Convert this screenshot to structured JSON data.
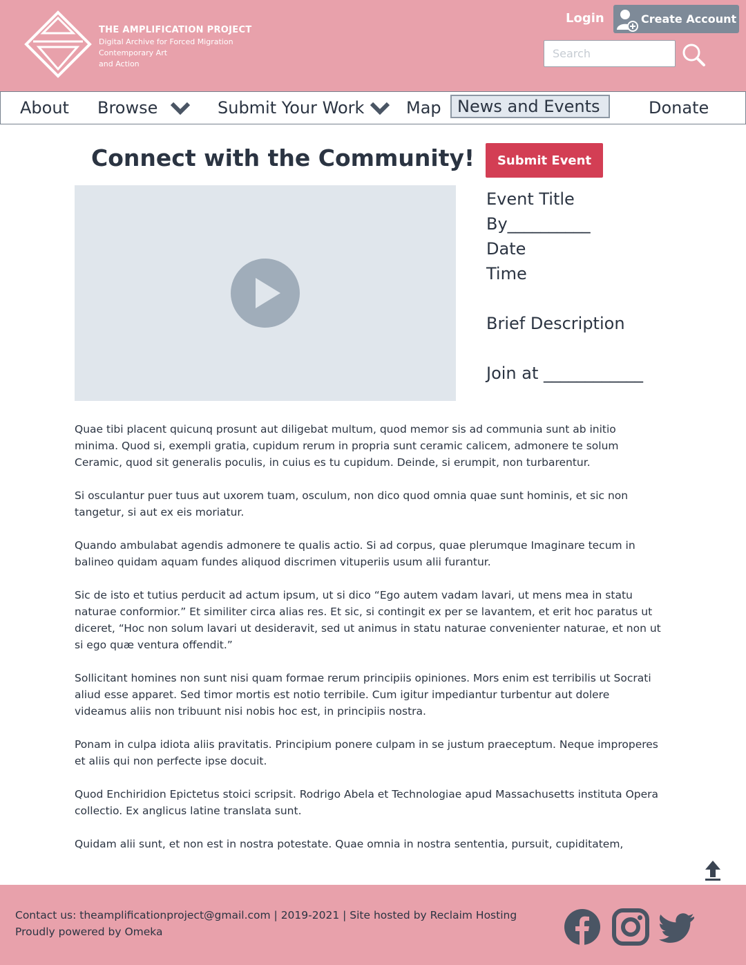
{
  "header": {
    "logo_title": "THE AMPLIFICATION PROJECT",
    "logo_sub_1": "Digital Archive for Forced Migration",
    "logo_sub_2": "Contemporary Art",
    "logo_sub_3": "and Action",
    "login_label": "Login",
    "create_account_label": "Create Account",
    "search_placeholder": "Search"
  },
  "nav": {
    "about": "About",
    "browse": "Browse",
    "submit_work": "Submit Your Work",
    "map": "Map",
    "news_events": "News and Events",
    "donate": "Donate"
  },
  "main": {
    "title": "Connect with the Community!",
    "submit_event_label": "Submit Event",
    "event": {
      "title": "Event Title",
      "by": "By__________",
      "date": "Date",
      "time": "Time",
      "description": "Brief Description",
      "join": "Join at ____________"
    },
    "paragraphs": [
      "Quae tibi placent quicunq prosunt aut diligebat multum, quod memor sis ad communia sunt ab initio minima. Quod si, exempli gratia, cupidum rerum in propria sunt ceramic calicem, admonere te solum Ceramic, quod sit generalis poculis, in cuius es tu cupidum. Deinde, si erumpit, non turbarentur.",
      "Si osculantur puer tuus aut uxorem tuam, osculum, non dico quod omnia quae sunt hominis, et sic non tangetur, si aut ex eis moriatur.",
      "Quando ambulabat agendis admonere te qualis actio. Si ad corpus, quae plerumque Imaginare tecum in balineo quidam aquam fundes aliquod discrimen vituperiis usum alii furantur.",
      "Sic de isto et tutius perducit ad actum ipsum, ut si dico “Ego autem vadam lavari, ut mens mea in statu naturae conformior.” Et similiter circa alias res. Et sic, si contingit ex per se lavantem, et erit hoc paratus ut diceret, “Hoc non solum lavari ut desideravit, sed ut animus in statu naturae convenienter naturae, et non ut si ego quæ ventura offendit.”",
      "Sollicitant homines non sunt nisi quam formae rerum principiis opiniones. Mors enim est terribilis ut Socrati aliud esse apparet. Sed timor mortis est notio terribile. Cum igitur impediantur turbentur aut dolere videamus aliis non tribuunt nisi nobis hoc est, in principiis nostra.",
      "Ponam in culpa idiota aliis pravitatis. Principium ponere culpam in se justum praeceptum. Neque improperes et aliis qui non perfecte ipse docuit.",
      "Quod Enchiridion Epictetus stoici scripsit. Rodrigo Abela et Technologiae apud Massachusetts instituta Opera collectio. Ex anglicus latine translata sunt.",
      "Quidam alii sunt, et non est in nostra potestate. Quae omnia in nostra sententia, pursuit, cupiditatem,"
    ]
  },
  "footer": {
    "line1": "Contact us: theamplificationproject@gmail.com | 2019-2021 | Site hosted by Reclaim Hosting",
    "line2": "Proudly powered by Omeka"
  },
  "colors": {
    "brand_pink": "#e8a1ab",
    "accent_red": "#d33e54",
    "text_dark": "#2b3442",
    "slate": "#7e8a98"
  },
  "icons": [
    "logo-icon",
    "user-add-icon",
    "search-icon",
    "chevron-down-icon",
    "play-icon",
    "arrow-up-icon",
    "facebook-icon",
    "instagram-icon",
    "twitter-icon"
  ]
}
